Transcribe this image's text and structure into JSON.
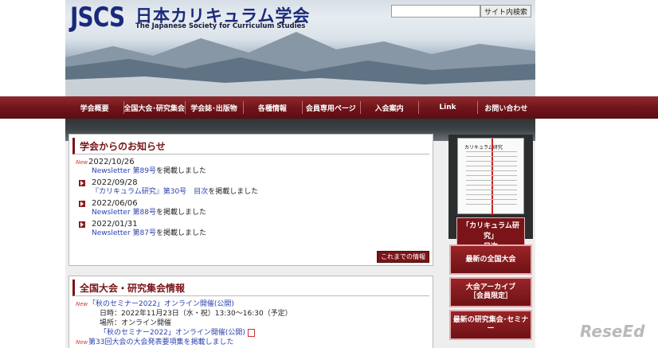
{
  "header": {
    "logo_short": "JSCS",
    "logo_jp": "日本カリキュラム学会",
    "logo_en": "The Japanese Society for Curriculum Studies"
  },
  "search": {
    "placeholder": "",
    "button": "サイト内検索"
  },
  "nav": [
    "学会概要",
    "全国大会･研究集会",
    "学会誌･出版物",
    "各種情報",
    "会員専用ページ",
    "入会案内",
    "Link",
    "お問い合わせ"
  ],
  "notices": {
    "title": "学会からのお知らせ",
    "more": "これまでの情報",
    "items": [
      {
        "new": "New",
        "date": "2022/10/26",
        "link": "Newsletter 第89号",
        "rest": "を掲載しました"
      },
      {
        "date": "2022/09/28",
        "link": "『カリキュラム研究』第30号　目次",
        "rest": "を掲載しました"
      },
      {
        "date": "2022/06/06",
        "link": "Newsletter 第88号",
        "rest": "を掲載しました"
      },
      {
        "date": "2022/01/31",
        "link": "Newsletter 第87号",
        "rest": "を掲載しました"
      }
    ]
  },
  "events": {
    "title": "全国大会・研究集会情報",
    "item1": {
      "new": "New",
      "link": "「秋のセミナー2022」オンライン開催(公開)",
      "date_line": "日時：2022年11月23日（水・祝）13:30～16:30（予定）",
      "place_line": "場所：オンライン開催",
      "pdf_link": "「秋のセミナー2022」オンライン開催(公開)"
    },
    "item2": {
      "new": "New",
      "link": "第33回大会の大会発表要項集を掲載しました"
    }
  },
  "sidebar": {
    "book_title": "カリキュラム研究",
    "caption_line1": "「カリキュラム研究」",
    "caption_line2": "目次",
    "buttons": [
      "最新の全国大会",
      "大会アーカイブ\n［会員限定］",
      "最新の研究集会･セミナー"
    ]
  },
  "watermark": "ReseEd"
}
